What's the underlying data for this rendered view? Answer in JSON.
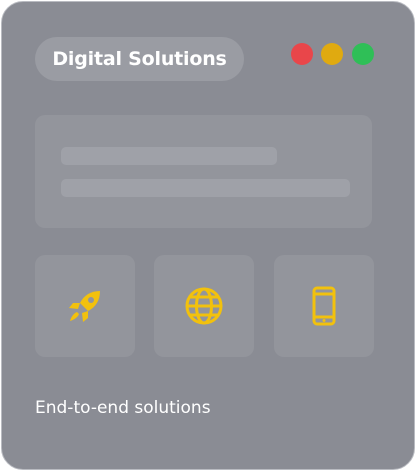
{
  "header": {
    "title": "Digital Solutions",
    "window_controls": [
      {
        "name": "close",
        "color": "#e9464a"
      },
      {
        "name": "minimize",
        "color": "#e0aa10"
      },
      {
        "name": "maximize",
        "color": "#2fbf57"
      }
    ]
  },
  "features": {
    "icon_color": "#f2c10d",
    "tiles": [
      {
        "icon": "rocket-icon"
      },
      {
        "icon": "globe-icon"
      },
      {
        "icon": "mobile-phone-icon"
      }
    ]
  },
  "caption": "End-to-end solutions"
}
